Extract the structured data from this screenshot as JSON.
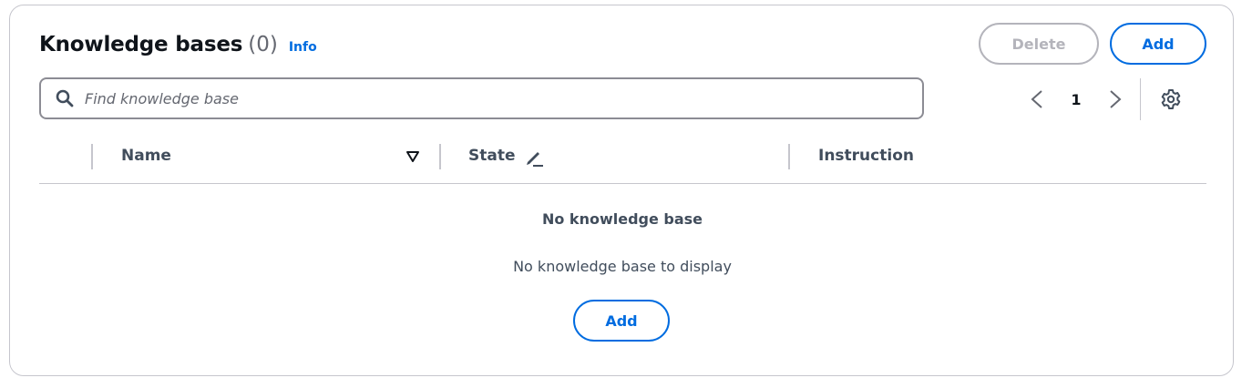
{
  "header": {
    "title": "Knowledge bases",
    "count": "(0)",
    "info_label": "Info"
  },
  "actions": {
    "delete_label": "Delete",
    "add_label": "Add"
  },
  "search": {
    "placeholder": "Find knowledge base",
    "value": ""
  },
  "pagination": {
    "current_page": "1"
  },
  "table": {
    "columns": [
      "Name",
      "State",
      "Instruction"
    ]
  },
  "empty_state": {
    "title": "No knowledge base",
    "description": "No knowledge base to display",
    "add_label": "Add"
  },
  "icons": {
    "search": "search-icon",
    "prev": "chevron-left-icon",
    "next": "chevron-right-icon",
    "settings": "gear-icon",
    "sort": "sort-down-icon",
    "edit": "pencil-icon"
  },
  "colors": {
    "accent": "#006ce0",
    "disabled": "#b4b4bb",
    "text": "#0f141a",
    "muted": "#414d5c",
    "border": "#c6c6cd"
  }
}
